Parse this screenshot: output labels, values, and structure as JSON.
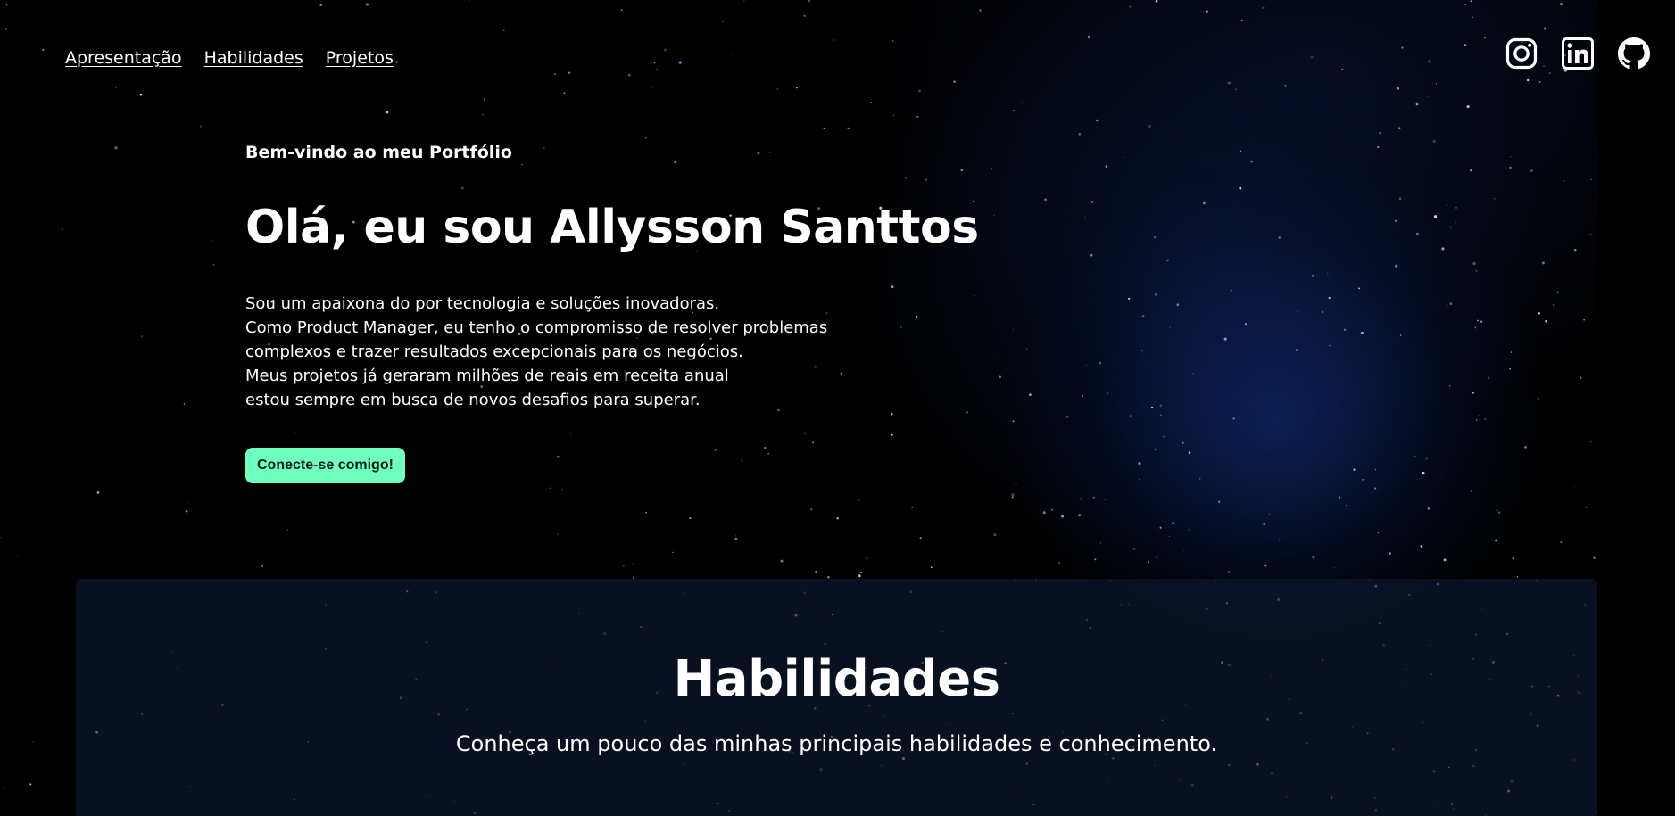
{
  "nav": {
    "items": [
      {
        "label": "Apresentação"
      },
      {
        "label": "Habilidades"
      },
      {
        "label": "Projetos"
      }
    ]
  },
  "social": {
    "icons": [
      "instagram-icon",
      "linkedin-icon",
      "github-icon"
    ]
  },
  "hero": {
    "welcome": "Bem-vindo ao meu Portfólio",
    "headline": "Olá, eu sou Allysson Santtos",
    "intro": [
      "Sou um apaixona do por tecnologia e soluções inovadoras.",
      "Como Product Manager, eu tenho o compromisso de resolver problemas",
      "complexos e trazer resultados excepcionais para os negócios.",
      "Meus projetos já geraram milhões de reais em receita anual",
      "estou sempre em busca de novos desafios para superar."
    ],
    "cta_label": "Conecte-se comigo!"
  },
  "skills": {
    "title": "Habilidades",
    "subtitle": "Conheça um pouco das minhas principais habilidades e conhecimento."
  },
  "colors": {
    "background": "#000000",
    "accent": "#6fffbe",
    "text": "#ffffff"
  }
}
